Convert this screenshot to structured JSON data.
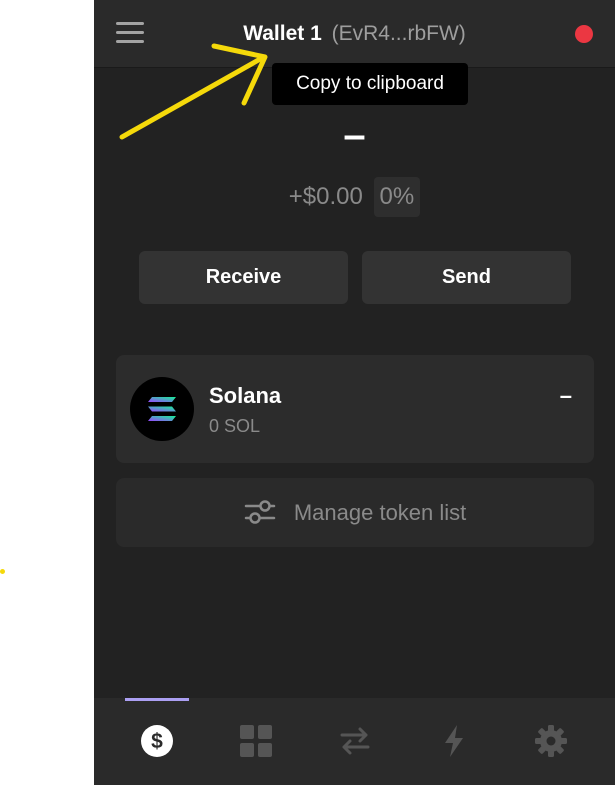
{
  "header": {
    "wallet_name": "Wallet 1",
    "wallet_address": "(EvR4...rbFW)",
    "status_color": "#eb3742"
  },
  "tooltip": {
    "text": "Copy to clipboard"
  },
  "balance": {
    "total": "–",
    "change_amount": "+$0.00",
    "change_percent": "0%"
  },
  "actions": {
    "receive_label": "Receive",
    "send_label": "Send"
  },
  "tokens": [
    {
      "name": "Solana",
      "amount": "0 SOL",
      "value": "–",
      "icon": "solana-logo-icon"
    }
  ],
  "manage": {
    "label": "Manage token list",
    "icon": "sliders-icon"
  },
  "bottom_nav": {
    "items": [
      {
        "icon": "dollar-icon",
        "active": true
      },
      {
        "icon": "grid-icon",
        "active": false
      },
      {
        "icon": "swap-icon",
        "active": false
      },
      {
        "icon": "lightning-icon",
        "active": false
      },
      {
        "icon": "gear-icon",
        "active": false
      }
    ],
    "active_color": "#ab9ff2"
  },
  "annotation": {
    "arrow_color": "#f5d90a"
  }
}
